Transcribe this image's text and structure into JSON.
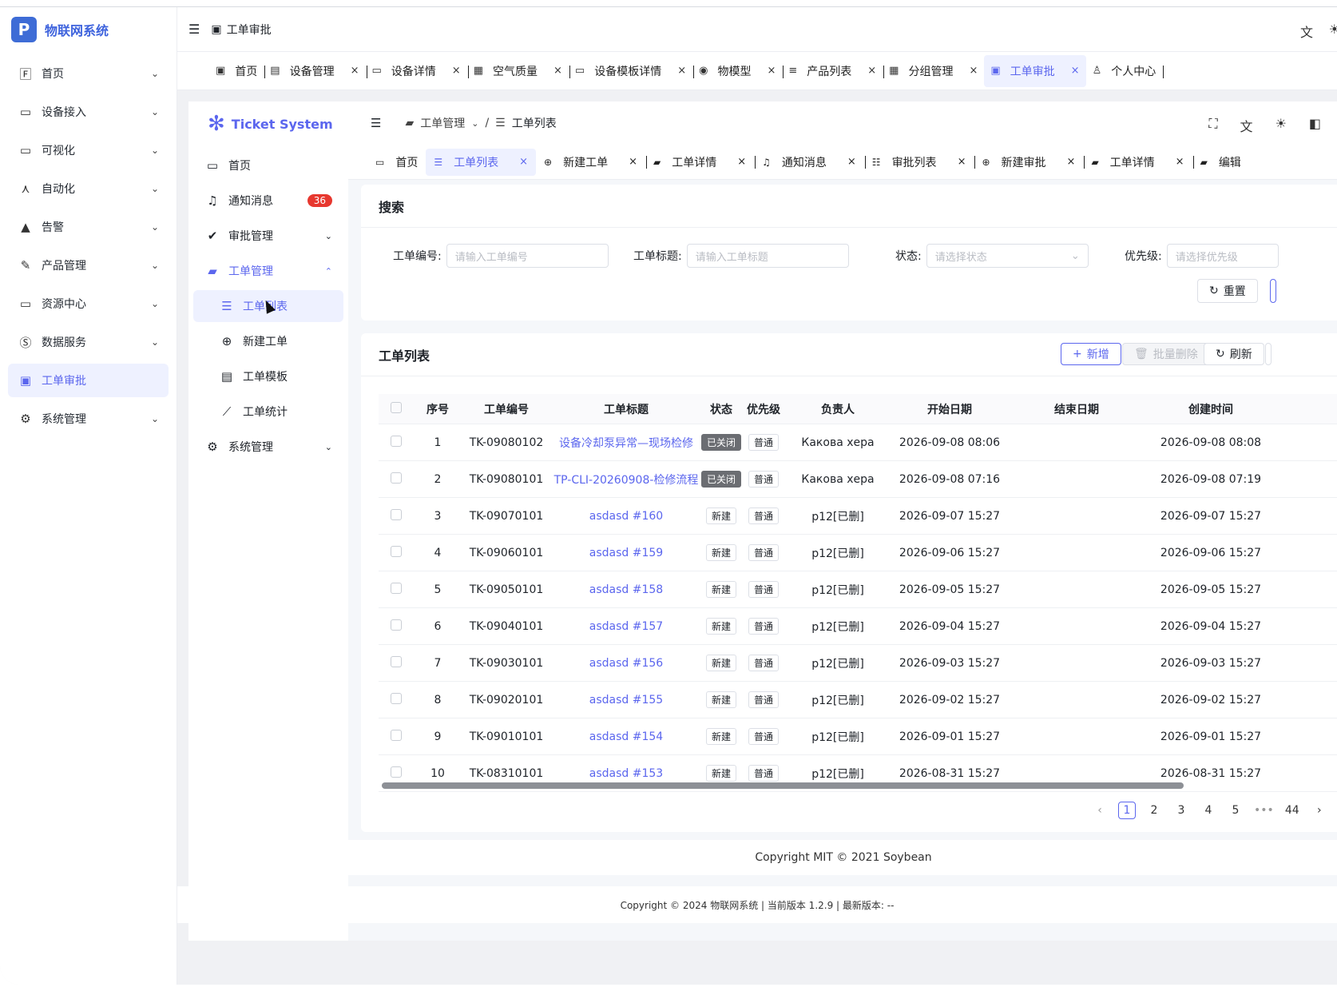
{
  "outer": {
    "app_name": "物联网系统",
    "logo_letter": "P",
    "nav": [
      {
        "label": "首页",
        "icon": "home-icon"
      },
      {
        "label": "设备接入",
        "icon": "monitor-icon"
      },
      {
        "label": "可视化",
        "icon": "tablet-icon"
      },
      {
        "label": "自动化",
        "icon": "network-icon"
      },
      {
        "label": "告警",
        "icon": "warning-icon"
      },
      {
        "label": "产品管理",
        "icon": "document-edit-icon"
      },
      {
        "label": "资源中心",
        "icon": "tablet-icon"
      },
      {
        "label": "数据服务",
        "icon": "s-circle-icon"
      },
      {
        "label": "工单审批",
        "icon": "approval-icon"
      },
      {
        "label": "系统管理",
        "icon": "settings-monitor-icon"
      }
    ],
    "header_title": "工单审批",
    "tabs": [
      "首页",
      "设备管理",
      "设备详情",
      "空气质量",
      "设备模板详情",
      "物模型",
      "产品列表",
      "分组管理",
      "工单审批",
      "个人中心"
    ],
    "footer": "Copyright © 2024 物联网系统 | 当前版本 1.2.9 | 最新版本: --"
  },
  "inner": {
    "app_name": "Ticket System",
    "nav": {
      "home": "首页",
      "notifications": "通知消息",
      "notification_count": "36",
      "approval": "审批管理",
      "ticket_mgmt": "工单管理",
      "ticket_list": "工单列表",
      "new_ticket": "新建工单",
      "ticket_template": "工单模板",
      "ticket_stats": "工单统计",
      "system": "系统管理"
    },
    "breadcrumb": {
      "parent": "工单管理",
      "current": "工单列表"
    },
    "tabs": [
      "首页",
      "工单列表",
      "新建工单",
      "工单详情",
      "通知消息",
      "审批列表",
      "新建审批",
      "工单详情",
      "编辑"
    ],
    "search": {
      "title": "搜索",
      "ticket_no_label": "工单编号:",
      "ticket_no_placeholder": "请输入工单编号",
      "ticket_title_label": "工单标题:",
      "ticket_title_placeholder": "请输入工单标题",
      "status_label": "状态:",
      "status_placeholder": "请选择状态",
      "priority_label": "优先级:",
      "priority_placeholder": "请选择优先级",
      "reset": "重置"
    },
    "list": {
      "title": "工单列表",
      "add": "新增",
      "batch_delete": "批量删除",
      "refresh": "刷新",
      "columns": [
        "序号",
        "工单编号",
        "工单标题",
        "状态",
        "优先级",
        "负责人",
        "开始日期",
        "结束日期",
        "创建时间"
      ],
      "rows": [
        {
          "no": "1",
          "code": "TK-09080102",
          "title": "设备冷却泵异常—现场检修",
          "status": "已关闭",
          "priority": "普通",
          "owner": "Какова хера",
          "start": "2026-09-08 08:06",
          "end": "",
          "created": "2026-09-08 08:08"
        },
        {
          "no": "2",
          "code": "TK-09080101",
          "title": "TP-CLI-20260908-检修流程",
          "status": "已关闭",
          "priority": "普通",
          "owner": "Какова хера",
          "start": "2026-09-08 07:16",
          "end": "",
          "created": "2026-09-08 07:19"
        },
        {
          "no": "3",
          "code": "TK-09070101",
          "title": "asdasd #160",
          "status": "新建",
          "priority": "普通",
          "owner": "p12[已删]",
          "start": "2026-09-07 15:27",
          "end": "",
          "created": "2026-09-07 15:27"
        },
        {
          "no": "4",
          "code": "TK-09060101",
          "title": "asdasd #159",
          "status": "新建",
          "priority": "普通",
          "owner": "p12[已删]",
          "start": "2026-09-06 15:27",
          "end": "",
          "created": "2026-09-06 15:27"
        },
        {
          "no": "5",
          "code": "TK-09050101",
          "title": "asdasd #158",
          "status": "新建",
          "priority": "普通",
          "owner": "p12[已删]",
          "start": "2026-09-05 15:27",
          "end": "",
          "created": "2026-09-05 15:27"
        },
        {
          "no": "6",
          "code": "TK-09040101",
          "title": "asdasd #157",
          "status": "新建",
          "priority": "普通",
          "owner": "p12[已删]",
          "start": "2026-09-04 15:27",
          "end": "",
          "created": "2026-09-04 15:27"
        },
        {
          "no": "7",
          "code": "TK-09030101",
          "title": "asdasd #156",
          "status": "新建",
          "priority": "普通",
          "owner": "p12[已删]",
          "start": "2026-09-03 15:27",
          "end": "",
          "created": "2026-09-03 15:27"
        },
        {
          "no": "8",
          "code": "TK-09020101",
          "title": "asdasd #155",
          "status": "新建",
          "priority": "普通",
          "owner": "p12[已删]",
          "start": "2026-09-02 15:27",
          "end": "",
          "created": "2026-09-02 15:27"
        },
        {
          "no": "9",
          "code": "TK-09010101",
          "title": "asdasd #154",
          "status": "新建",
          "priority": "普通",
          "owner": "p12[已删]",
          "start": "2026-09-01 15:27",
          "end": "",
          "created": "2026-09-01 15:27"
        },
        {
          "no": "10",
          "code": "TK-08310101",
          "title": "asdasd #153",
          "status": "新建",
          "priority": "普通",
          "owner": "p12[已删]",
          "start": "2026-08-31 15:27",
          "end": "",
          "created": "2026-08-31 15:27"
        }
      ],
      "pagination": {
        "pages": [
          "1",
          "2",
          "3",
          "4",
          "5"
        ],
        "ellipsis": "•••",
        "last": "44",
        "current": "1"
      }
    },
    "footer": "Copyright MIT © 2021 Soybean"
  },
  "colors": {
    "accent": "#5b66ee",
    "badge": "#e7382f",
    "closed_tag": "#6b6d72"
  }
}
